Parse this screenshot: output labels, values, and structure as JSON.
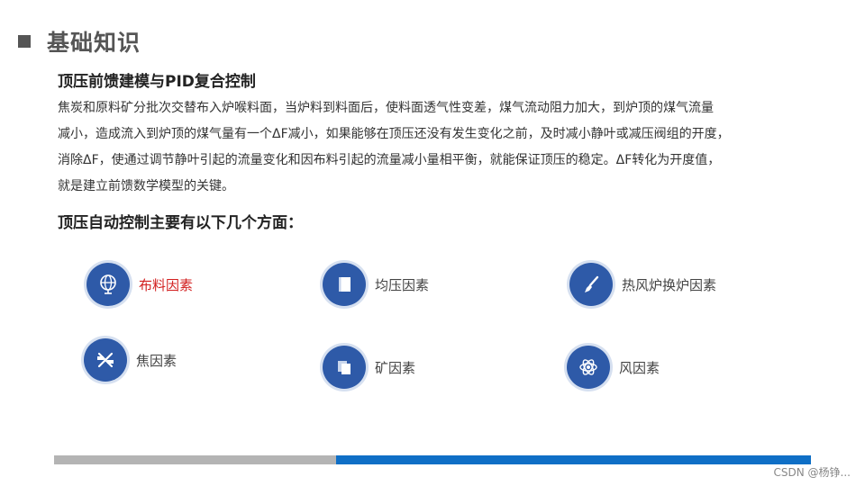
{
  "page": {
    "title": "基础知识",
    "subtitle": "顶压前馈建模与PID复合控制",
    "paragraph_lines": [
      "焦炭和原料矿分批次交替布入炉喉料面，当炉料到料面后，使料面透气性变差，煤气流动阻力加大，到炉顶的煤气流量",
      "减小，造成流入到炉顶的煤气量有一个ΔF减小，如果能够在顶压还没有发生变化之前，及时减小静叶或减压阀组的开度，",
      "消除ΔF，使通过调节静叶引起的流量变化和因布料引起的流量减小量相平衡，就能保证顶压的稳定。ΔF转化为开度值，",
      "就是建立前馈数学模型的关键。"
    ],
    "section_heading": "顶压自动控制主要有以下几个方面："
  },
  "factors": [
    {
      "label": "布料因素",
      "icon": "globe-icon",
      "color": "#d21f1f"
    },
    {
      "label": "均压因素",
      "icon": "book-icon",
      "color": "#444444"
    },
    {
      "label": "热风炉换炉因素",
      "icon": "brush-icon",
      "color": "#444444"
    },
    {
      "label": "焦因素",
      "icon": "scissors-icon",
      "color": "#444444"
    },
    {
      "label": "矿因素",
      "icon": "copy-icon",
      "color": "#444444"
    },
    {
      "label": "风因素",
      "icon": "atom-icon",
      "color": "#444444"
    }
  ],
  "progress": {
    "segment_split": 0.373,
    "track_color": "#b4b4b4",
    "fill_color": "#0f6fc6"
  },
  "watermark": "CSDN @杨铮..."
}
